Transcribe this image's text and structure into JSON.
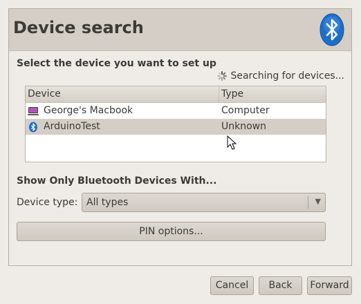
{
  "header": {
    "title": "Device search",
    "icon": "bluetooth-icon"
  },
  "main": {
    "select_label": "Select the device you want to set up",
    "searching_status": "Searching for devices...",
    "list": {
      "columns": [
        "Device",
        "Type"
      ],
      "rows": [
        {
          "icon": "computer-icon",
          "device": "George's Macbook",
          "type": "Computer",
          "selected": false
        },
        {
          "icon": "bluetooth-icon",
          "device": "ArduinoTest",
          "type": "Unknown",
          "selected": true
        }
      ]
    },
    "filter_label": "Show Only Bluetooth Devices With...",
    "device_type_label": "Device type:",
    "device_type_value": "All types",
    "pin_options_label": "PIN options..."
  },
  "footer": {
    "cancel": "Cancel",
    "back": "Back",
    "forward": "Forward"
  },
  "colors": {
    "bluetooth_blue": "#1d6fc9",
    "header_bg": "#d4cec6",
    "selected_row": "#d4cec6"
  }
}
